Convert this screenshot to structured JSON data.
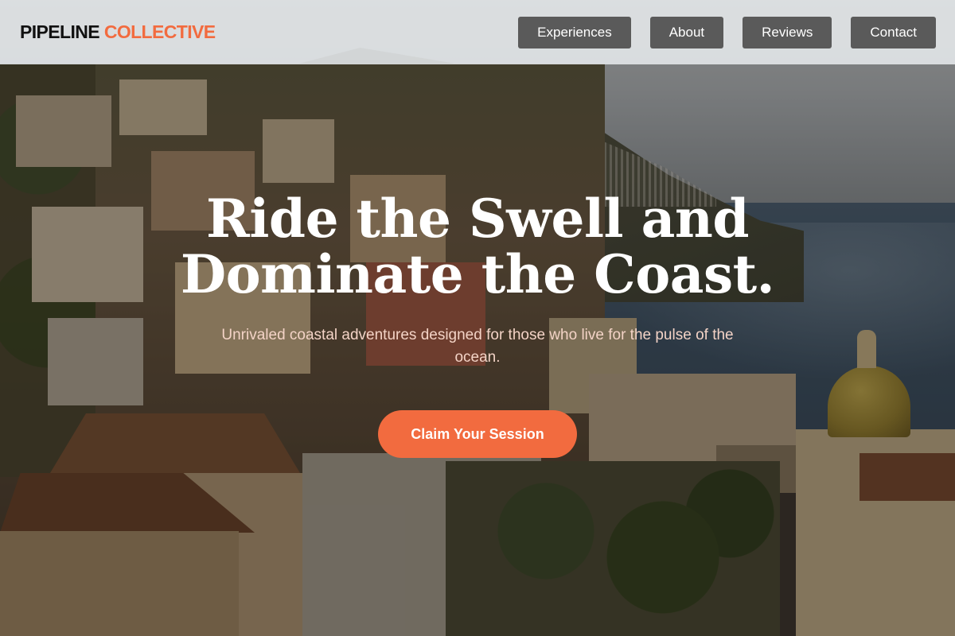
{
  "brand": {
    "name_part1": "PIPELINE",
    "name_part2": "COLLECTIVE",
    "accent_color": "#f26b3f"
  },
  "nav": {
    "items": [
      {
        "label": "Experiences"
      },
      {
        "label": "About"
      },
      {
        "label": "Reviews"
      },
      {
        "label": "Contact"
      }
    ]
  },
  "hero": {
    "title_line1": "Ride the Swell and",
    "title_line2": "Dominate the Coast.",
    "subtitle": "Unrivaled coastal adventures designed for those who live for the pulse of the ocean.",
    "cta_label": "Claim Your Session"
  }
}
